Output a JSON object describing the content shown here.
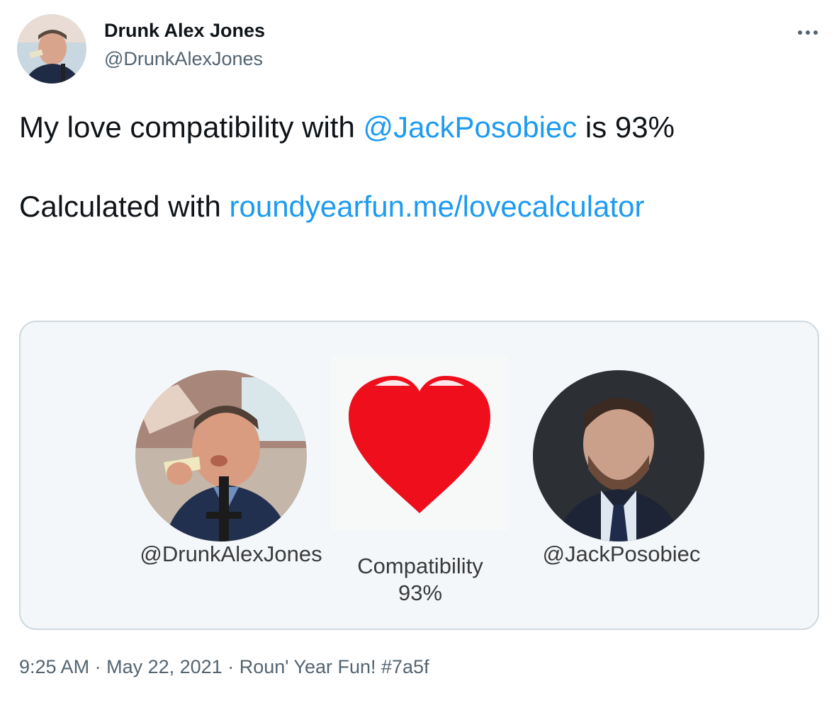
{
  "author": {
    "display_name": "Drunk Alex Jones",
    "handle": "@DrunkAlexJones",
    "avatar_icon": "profile-photo"
  },
  "more_icon": "more-horizontal-icon",
  "tweet": {
    "line1_prefix": "My love compatibility with ",
    "mention": "@JackPosobiec",
    "line1_suffix": " is 93%",
    "line2_prefix": "Calculated with ",
    "link": "roundyearfun.me/lovecalculator"
  },
  "card": {
    "left_handle": "@DrunkAlexJones",
    "right_handle": "@JackPosobiec",
    "compatibility_label": "Compatibility",
    "compatibility_value": "93%",
    "heart_color": "#ee0e1c"
  },
  "footer": {
    "time": "9:25 AM",
    "date": "May 22, 2021",
    "source": "Roun' Year Fun! #7a5f"
  },
  "colors": {
    "link": "#1d9bf0",
    "secondary_text": "#536471",
    "card_border": "#cfd9de",
    "card_background": "#f4f7fa"
  }
}
